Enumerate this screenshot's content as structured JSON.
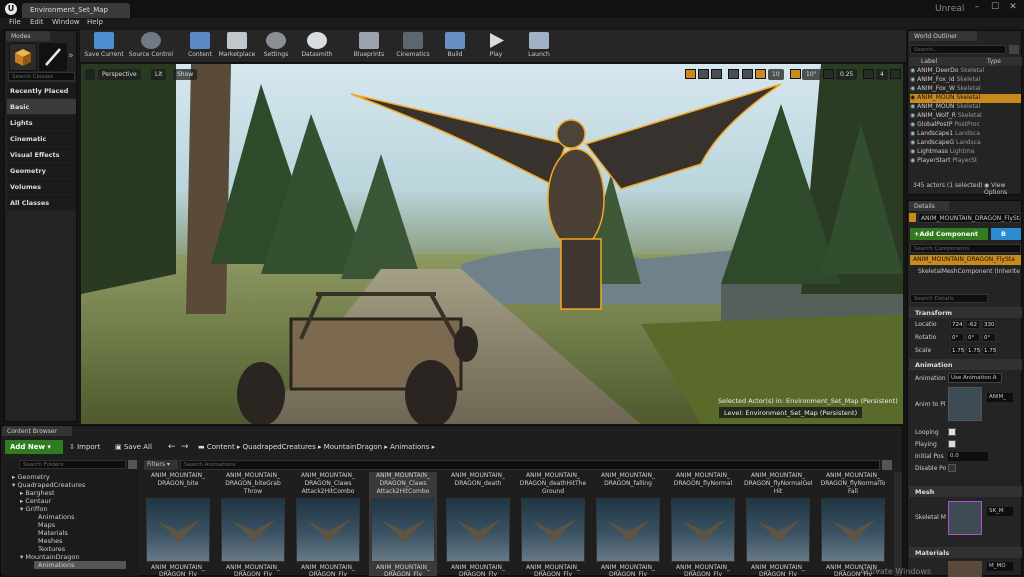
{
  "window": {
    "tab_title": "Environment_Set_Map",
    "brand": "Unreal",
    "controls": [
      "–",
      "☐",
      "✕"
    ]
  },
  "menu": [
    "File",
    "Edit",
    "Window",
    "Help"
  ],
  "modes": {
    "tab": "Modes",
    "search_placeholder": "Search Classes",
    "items": [
      "Recently Placed",
      "Basic",
      "Lights",
      "Cinematic",
      "Visual Effects",
      "Geometry",
      "Volumes",
      "All Classes"
    ]
  },
  "toolbar": [
    "Save Current",
    "Source Control",
    "Content",
    "Marketplace",
    "Settings",
    "Datasmith",
    "Blueprints",
    "Cinematics",
    "Build",
    "Play",
    "Launch"
  ],
  "viewport": {
    "perspective": "Perspective",
    "lit": "Lit",
    "show": "Show",
    "grid_snap": "10",
    "rot_snap": "10°",
    "scale_snap": "0.25",
    "cam_speed": "4",
    "selected_text": "Selected Actor(s) in:  Environment_Set_Map (Persistent)",
    "level_text": "Level:  Environment_Set_Map (Persistent)"
  },
  "outliner": {
    "tab": "World Outliner",
    "search_placeholder": "Search...",
    "col_label": "Label",
    "col_type": "Type",
    "rows": [
      {
        "label": "ANIM_DeerDo",
        "type": "Skeletal"
      },
      {
        "label": "ANIM_Fox_Id",
        "type": "Skeletal"
      },
      {
        "label": "ANIM_Fox_W",
        "type": "Skeletal"
      },
      {
        "label": "ANIM_MOUN",
        "type": "Skeletal"
      },
      {
        "label": "ANIM_MOUN",
        "type": "Skeletal"
      },
      {
        "label": "ANIM_Wolf_R",
        "type": "Skeletal"
      },
      {
        "label": "GlobalPostP",
        "type": "PostProc"
      },
      {
        "label": "Landscape1",
        "type": "Landsca"
      },
      {
        "label": "LandscapeG",
        "type": "Landsca"
      },
      {
        "label": "Lightmass",
        "type": "Lightma"
      },
      {
        "label": "PlayerStart",
        "type": "PlayerSt"
      }
    ],
    "count": "345 actors (1 selected)",
    "view_options": "View Options"
  },
  "details": {
    "tab": "Details",
    "name_value": "ANIM_MOUNTAIN_DRAGON_FlySta",
    "add_component": "+Add Component",
    "bp_btn": "B",
    "search_components": "Search Components",
    "component_root": "ANIM_MOUNTAIN_DRAGON_FlySta",
    "component_child": "SkeletalMeshComponent (Inherite",
    "search_details": "Search Details",
    "transform": "Transform",
    "location": {
      "label": "Locatio",
      "x": "724",
      "y": "-62",
      "z": "330"
    },
    "rotation": {
      "label": "Rotatio",
      "x": "0°",
      "y": "0°",
      "z": "0°"
    },
    "scale": {
      "label": "Scale",
      "x": "1.75",
      "y": "1.75",
      "z": "1.75"
    },
    "animation": "Animation",
    "anim_mode_label": "Animation",
    "anim_mode_value": "Use Animation A",
    "anim_to_play_label": "Anim to Pl",
    "anim_asset": "ANIM_",
    "looping": "Looping",
    "playing": "Playing",
    "initial_pos": "Initial Pos",
    "initial_pos_value": "0.0",
    "disable_pp": "Disable Po",
    "mesh": "Mesh",
    "skeletal_mesh_label": "Skeletal M",
    "skeletal_mesh_value": "SK_M",
    "materials": "Materials",
    "material_value": "M_MO"
  },
  "content_browser": {
    "tab": "Content Browser",
    "add_new": "Add New",
    "import": "Import",
    "save_all": "Save All",
    "path": [
      "Content",
      "QuadrapedCreatures",
      "MountainDragon",
      "Animations"
    ],
    "search_folders": "Search Folders",
    "filters": "Filters",
    "search_assets": "Search Animations",
    "tree": [
      "Geometry",
      "QuadrapedCreatures",
      "Barghest",
      "Centaur",
      "Griffon",
      "Animations",
      "Maps",
      "Materials",
      "Meshes",
      "Textures",
      "MountainDragon",
      "Animations"
    ],
    "top_row": [
      "ANIM_MOUNTAIN_\nDRAGON_bite",
      "ANIM_MOUNTAIN_\nDRAGON_biteGrab\nThrow",
      "ANIM_MOUNTAIN_\nDRAGON_Claws\nAttack2HitCombo",
      "ANIM_MOUNTAIN_\nDRAGON_Claws\nAttack2HitCombo",
      "ANIM_MOUNTAIN_\nDRAGON_death",
      "ANIM_MOUNTAIN_\nDRAGON_deathHitThe\nGround",
      "ANIM_MOUNTAIN_\nDRAGON_falling",
      "ANIM_MOUNTAIN_\nDRAGON_flyNormal",
      "ANIM_MOUNTAIN_\nDRAGON_flyNormalGet\nHit",
      "ANIM_MOUNTAIN_\nDRAGON_flyNormalTo\nFall"
    ],
    "bottom_row": [
      "ANIM_MOUNTAIN_\nDRAGON_Fly",
      "ANIM_MOUNTAIN_\nDRAGON_Fly",
      "ANIM_MOUNTAIN_\nDRAGON_Fly",
      "ANIM_MOUNTAIN_\nDRAGON_Fly",
      "ANIM_MOUNTAIN_\nDRAGON_Fly",
      "ANIM_MOUNTAIN_\nDRAGON_Fly",
      "ANIM_MOUNTAIN_\nDRAGON_Fly",
      "ANIM_MOUNTAIN_\nDRAGON_Fly",
      "ANIM_MOUNTAIN_\nDRAGON_Fly",
      "ANIM_MOUNTAIN_\nDRAGON_Fly"
    ]
  },
  "watermark": "Activate Windows",
  "colors": {
    "accent": "#2d8bd4",
    "selection_orange": "#f5a623",
    "add_green": "#2f7d1e"
  }
}
